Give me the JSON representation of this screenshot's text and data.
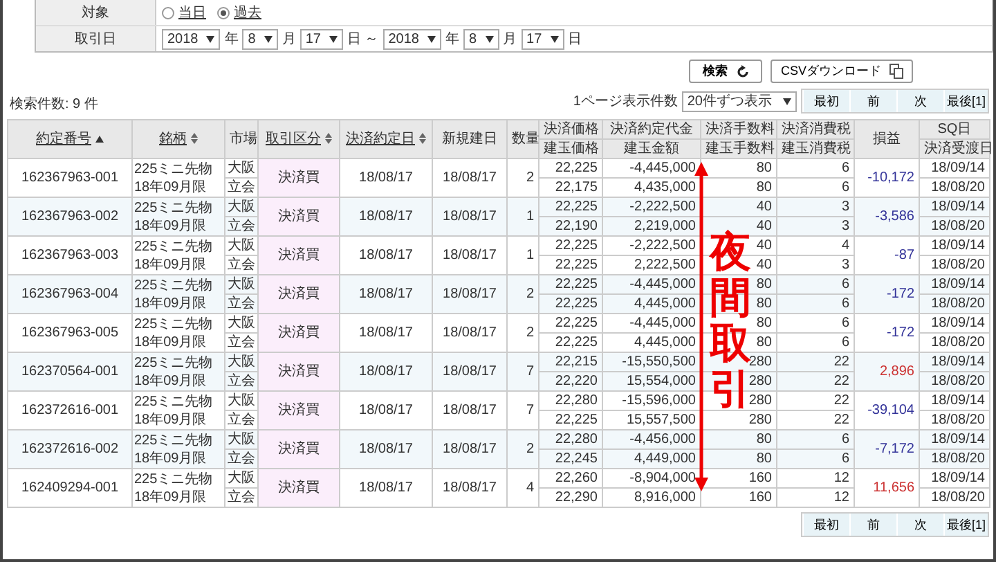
{
  "filter": {
    "rows": [
      {
        "label": "対象",
        "kind": "radio",
        "options": [
          {
            "label": "当日",
            "selected": false
          },
          {
            "label": "過去",
            "selected": true
          }
        ]
      },
      {
        "label": "取引日",
        "kind": "date_range",
        "parts": [
          {
            "kind": "select",
            "value": "2018"
          },
          {
            "kind": "text",
            "value": "年"
          },
          {
            "kind": "select",
            "value": "8"
          },
          {
            "kind": "text",
            "value": "月"
          },
          {
            "kind": "select",
            "value": "17"
          },
          {
            "kind": "text",
            "value": "日 ～"
          },
          {
            "kind": "select",
            "value": "2018"
          },
          {
            "kind": "text",
            "value": "年"
          },
          {
            "kind": "select",
            "value": "8"
          },
          {
            "kind": "text",
            "value": "月"
          },
          {
            "kind": "select",
            "value": "17"
          },
          {
            "kind": "text",
            "value": "日"
          }
        ]
      }
    ]
  },
  "buttons": {
    "search": "検索",
    "csv": "CSVダウンロード"
  },
  "result_count": "検索件数: 9 件",
  "page_size": {
    "label": "1ページ表示件数",
    "value": "20件ずつ表示"
  },
  "pager_top": [
    "最初",
    "前",
    "次",
    "最後[1]"
  ],
  "columns": [
    {
      "label": "約定番号",
      "link": true,
      "sorted": true
    },
    {
      "label": "銘柄",
      "link": true,
      "sorted": false
    },
    {
      "label": "市場",
      "link": false
    },
    {
      "label": "取引区分",
      "link": true,
      "sorted": false
    },
    {
      "label": "決済約定日",
      "link": true,
      "sorted": false
    },
    {
      "label": "新規建日",
      "link": false
    },
    {
      "label": "数量",
      "link": false
    },
    {
      "top": "決済価格",
      "bottom": "建玉価格"
    },
    {
      "top": "決済約定代金",
      "bottom": "建玉金額"
    },
    {
      "top": "決済手数料",
      "bottom": "建玉手数料"
    },
    {
      "top": "決済消費税",
      "bottom": "建玉消費税"
    },
    {
      "label": "損益",
      "link": false
    },
    {
      "top": "SQ日",
      "bottom": "決済受渡日"
    }
  ],
  "rows": [
    {
      "id": "162367963-001",
      "name": [
        "225ミニ先物",
        "18年09月限"
      ],
      "market": [
        "大阪",
        "立会"
      ],
      "type": "決済買",
      "date": "18/08/17",
      "open_date": "18/08/17",
      "qty": "2",
      "price": [
        "22,225",
        "22,175"
      ],
      "amount": [
        "-4,445,000",
        "4,435,000"
      ],
      "fee": [
        "80",
        "80"
      ],
      "tax": [
        "6",
        "6"
      ],
      "pnl": "-10,172",
      "color": "#333399",
      "dates": [
        "18/09/14",
        "18/08/20"
      ]
    },
    {
      "id": "162367963-002",
      "name": [
        "225ミニ先物",
        "18年09月限"
      ],
      "market": [
        "大阪",
        "立会"
      ],
      "type": "決済買",
      "date": "18/08/17",
      "open_date": "18/08/17",
      "qty": "1",
      "price": [
        "22,225",
        "22,190"
      ],
      "amount": [
        "-2,222,500",
        "2,219,000"
      ],
      "fee": [
        "40",
        "40"
      ],
      "tax": [
        "3",
        "3"
      ],
      "pnl": "-3,586",
      "color": "#333399",
      "dates": [
        "18/09/14",
        "18/08/20"
      ]
    },
    {
      "id": "162367963-003",
      "name": [
        "225ミニ先物",
        "18年09月限"
      ],
      "market": [
        "大阪",
        "立会"
      ],
      "type": "決済買",
      "date": "18/08/17",
      "open_date": "18/08/17",
      "qty": "1",
      "price": [
        "22,225",
        "22,225"
      ],
      "amount": [
        "-2,222,500",
        "2,222,500"
      ],
      "fee": [
        "40",
        "40"
      ],
      "tax": [
        "4",
        "3"
      ],
      "pnl": "-87",
      "color": "#333399",
      "dates": [
        "18/09/14",
        "18/08/20"
      ]
    },
    {
      "id": "162367963-004",
      "name": [
        "225ミニ先物",
        "18年09月限"
      ],
      "market": [
        "大阪",
        "立会"
      ],
      "type": "決済買",
      "date": "18/08/17",
      "open_date": "18/08/17",
      "qty": "2",
      "price": [
        "22,225",
        "22,225"
      ],
      "amount": [
        "-4,445,000",
        "4,445,000"
      ],
      "fee": [
        "80",
        "80"
      ],
      "tax": [
        "6",
        "6"
      ],
      "pnl": "-172",
      "color": "#333399",
      "dates": [
        "18/09/14",
        "18/08/20"
      ]
    },
    {
      "id": "162367963-005",
      "name": [
        "225ミニ先物",
        "18年09月限"
      ],
      "market": [
        "大阪",
        "立会"
      ],
      "type": "決済買",
      "date": "18/08/17",
      "open_date": "18/08/17",
      "qty": "2",
      "price": [
        "22,225",
        "22,225"
      ],
      "amount": [
        "-4,445,000",
        "4,445,000"
      ],
      "fee": [
        "80",
        "80"
      ],
      "tax": [
        "6",
        "6"
      ],
      "pnl": "-172",
      "color": "#333399",
      "dates": [
        "18/09/14",
        "18/08/20"
      ]
    },
    {
      "id": "162370564-001",
      "name": [
        "225ミニ先物",
        "18年09月限"
      ],
      "market": [
        "大阪",
        "立会"
      ],
      "type": "決済買",
      "date": "18/08/17",
      "open_date": "18/08/17",
      "qty": "7",
      "price": [
        "22,215",
        "22,220"
      ],
      "amount": [
        "-15,550,500",
        "15,554,000"
      ],
      "fee": [
        "280",
        "280"
      ],
      "tax": [
        "22",
        "22"
      ],
      "pnl": "2,896",
      "color": "#cc3333",
      "dates": [
        "18/09/14",
        "18/08/20"
      ]
    },
    {
      "id": "162372616-001",
      "name": [
        "225ミニ先物",
        "18年09月限"
      ],
      "market": [
        "大阪",
        "立会"
      ],
      "type": "決済買",
      "date": "18/08/17",
      "open_date": "18/08/17",
      "qty": "7",
      "price": [
        "22,280",
        "22,225"
      ],
      "amount": [
        "-15,596,000",
        "15,557,500"
      ],
      "fee": [
        "280",
        "280"
      ],
      "tax": [
        "22",
        "22"
      ],
      "pnl": "-39,104",
      "color": "#333399",
      "dates": [
        "18/09/14",
        "18/08/20"
      ]
    },
    {
      "id": "162372616-002",
      "name": [
        "225ミニ先物",
        "18年09月限"
      ],
      "market": [
        "大阪",
        "立会"
      ],
      "type": "決済買",
      "date": "18/08/17",
      "open_date": "18/08/17",
      "qty": "2",
      "price": [
        "22,280",
        "22,245"
      ],
      "amount": [
        "-4,456,000",
        "4,449,000"
      ],
      "fee": [
        "80",
        "80"
      ],
      "tax": [
        "6",
        "6"
      ],
      "pnl": "-7,172",
      "color": "#333399",
      "dates": [
        "18/09/14",
        "18/08/20"
      ]
    },
    {
      "id": "162409294-001",
      "name": [
        "225ミニ先物",
        "18年09月限"
      ],
      "market": [
        "大阪",
        "立会"
      ],
      "type": "決済買",
      "date": "18/08/17",
      "open_date": "18/08/17",
      "qty": "4",
      "price": [
        "22,260",
        "22,290"
      ],
      "amount": [
        "-8,904,000",
        "8,916,000"
      ],
      "fee": [
        "160",
        "160"
      ],
      "tax": [
        "12",
        "12"
      ],
      "pnl": "11,656",
      "color": "#cc3333",
      "dates": [
        "18/09/14",
        "18/08/20"
      ]
    }
  ],
  "annotation": {
    "text": "夜間取引"
  },
  "pager_bottom": [
    "最初",
    "前",
    "次",
    "最後[1]"
  ]
}
